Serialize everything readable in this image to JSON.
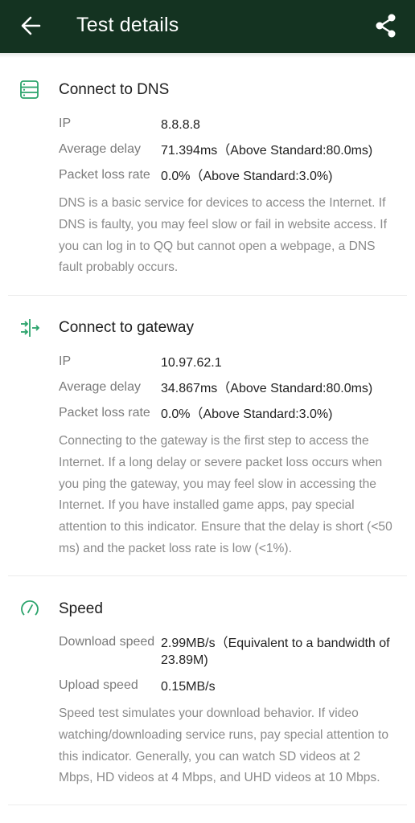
{
  "header": {
    "title": "Test details",
    "back_icon": "arrow-left-icon",
    "share_icon": "share-icon",
    "background": "#143321"
  },
  "accent_color": "#2aa36b",
  "sections": [
    {
      "icon": "server-icon",
      "title": "Connect to DNS",
      "rows": [
        {
          "label": "IP",
          "value": "8.8.8.8"
        },
        {
          "label": "Average delay",
          "value": "71.394ms（Above Standard:80.0ms)"
        },
        {
          "label": "Packet loss rate",
          "value": "0.0%（Above Standard:3.0%)"
        }
      ],
      "description": "DNS is a basic service for devices to access the Internet. If DNS is faulty, you may feel slow or fail in website access. If you can log in to QQ but cannot open a webpage, a DNS fault probably occurs."
    },
    {
      "icon": "gateway-icon",
      "title": "Connect to gateway",
      "rows": [
        {
          "label": "IP",
          "value": "10.97.62.1"
        },
        {
          "label": "Average delay",
          "value": "34.867ms（Above Standard:80.0ms)"
        },
        {
          "label": "Packet loss rate",
          "value": "0.0%（Above Standard:3.0%)"
        }
      ],
      "description": "Connecting to the gateway is the first step to access the Internet. If a long delay or severe packet loss occurs when you ping the gateway, you may feel slow in accessing the Internet. If you have installed game apps, pay special attention to this indicator. Ensure that the delay is short (<50 ms) and the packet loss rate is low (<1%)."
    },
    {
      "icon": "speedometer-icon",
      "title": "Speed",
      "rows": [
        {
          "label": "Download speed",
          "value": "2.99MB/s（Equivalent to a bandwidth of 23.89M)"
        },
        {
          "label": "Upload speed",
          "value": "0.15MB/s"
        }
      ],
      "description": "Speed test simulates your download behavior. If video watching/downloading service runs, pay special attention to this indicator. Generally, you can watch SD videos at 2 Mbps, HD videos at 4 Mbps, and UHD videos at 10 Mbps."
    }
  ]
}
